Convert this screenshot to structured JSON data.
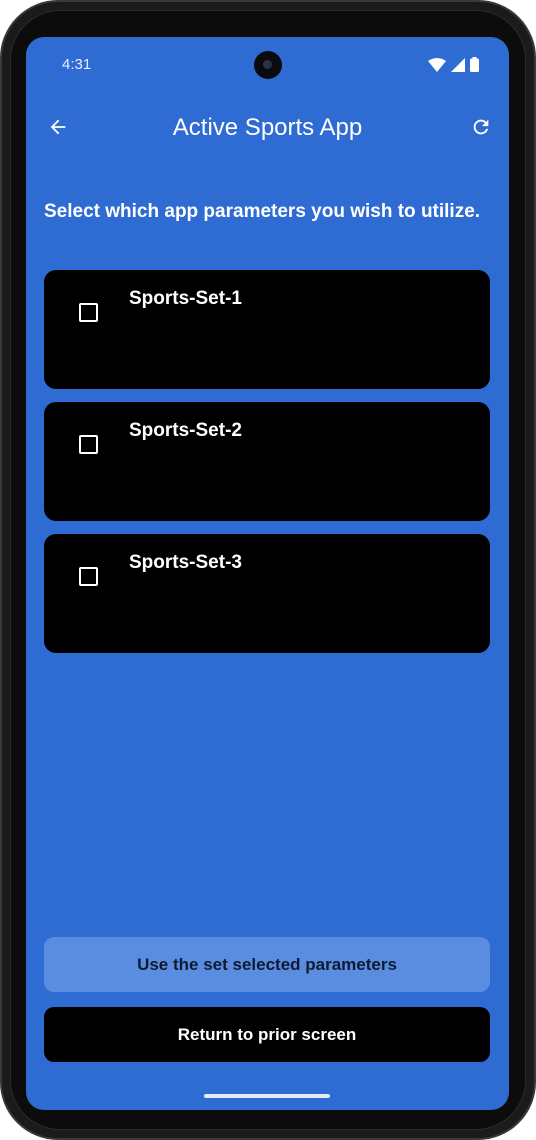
{
  "status_bar": {
    "time": "4:31",
    "icons": [
      "wifi-icon",
      "cellular-signal-icon",
      "battery-icon"
    ]
  },
  "app_bar": {
    "title": "Active Sports App",
    "back_icon": "arrow-back-icon",
    "refresh_icon": "refresh-icon"
  },
  "prompt": "Select which app parameters you wish to utilize.",
  "sets": [
    {
      "label": "Sports-Set-1",
      "checked": false
    },
    {
      "label": "Sports-Set-2",
      "checked": false
    },
    {
      "label": "Sports-Set-3",
      "checked": false
    }
  ],
  "actions": {
    "use_selected_label": "Use the set selected parameters",
    "return_label": "Return to prior screen"
  },
  "colors": {
    "background": "#2e6bd3",
    "card": "#000000",
    "primary_button": "#5a8de0",
    "text": "#ffffff"
  }
}
